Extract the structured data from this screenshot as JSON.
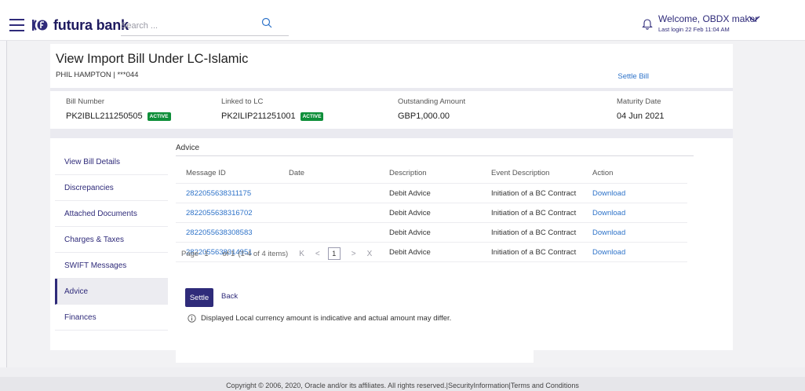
{
  "header": {
    "brand": "futura bank",
    "search_placeholder": "Search ...",
    "welcome": "Welcome, OBDX maker",
    "last_login": "Last login 22 Feb 11:04 AM"
  },
  "page": {
    "title": "View Import Bill Under LC-Islamic",
    "party": "PHIL HAMPTON | ***044",
    "settle_link": "Settle Bill"
  },
  "summary": [
    {
      "label": "Bill Number",
      "value": "PK2IBLL211250505",
      "badge": "ACTIVE"
    },
    {
      "label": "Linked to LC",
      "value": "PK2ILIP211251001",
      "badge": "ACTIVE"
    },
    {
      "label": "Outstanding Amount",
      "value": "GBP1,000.00"
    },
    {
      "label": "Maturity Date",
      "value": "04 Jun 2021"
    }
  ],
  "nav": {
    "items": [
      "View Bill Details",
      "Discrepancies",
      "Attached Documents",
      "Charges & Taxes",
      "SWIFT Messages",
      "Advice",
      "Finances"
    ],
    "active": "Advice"
  },
  "advice": {
    "title": "Advice",
    "columns": [
      "Message ID",
      "Date",
      "Description",
      "Event Description",
      "Action"
    ],
    "rows": [
      {
        "id": "2822055638311175",
        "date": "",
        "description": "Debit Advice",
        "event": "Initiation of a BC Contract",
        "action": "Download"
      },
      {
        "id": "2822055638316702",
        "date": "",
        "description": "Debit Advice",
        "event": "Initiation of a BC Contract",
        "action": "Download"
      },
      {
        "id": "2822055638308583",
        "date": "",
        "description": "Debit Advice",
        "event": "Initiation of a BC Contract",
        "action": "Download"
      },
      {
        "id": "2822055638314951",
        "date": "",
        "description": "Debit Advice",
        "event": "Initiation of a BC Contract",
        "action": "Download"
      }
    ]
  },
  "pagination": {
    "page_label": "Page",
    "page": "1",
    "of_label": "of 1",
    "items_label": "(1-4 of 4 items)",
    "first": "K",
    "prev": "<",
    "next": ">",
    "last": "X",
    "current": "1"
  },
  "actions": {
    "settle": "Settle",
    "back": "Back"
  },
  "disclaimer": "Displayed Local currency amount is indicative and actual amount may differ.",
  "footer": "Copyright © 2006, 2020, Oracle and/or its affiliates. All rights reserved.|SecurityInformation|Terms and Conditions",
  "colors": {
    "brand": "#2f2b7a",
    "link": "#2e73c9",
    "active_badge": "#0f8f3a"
  }
}
